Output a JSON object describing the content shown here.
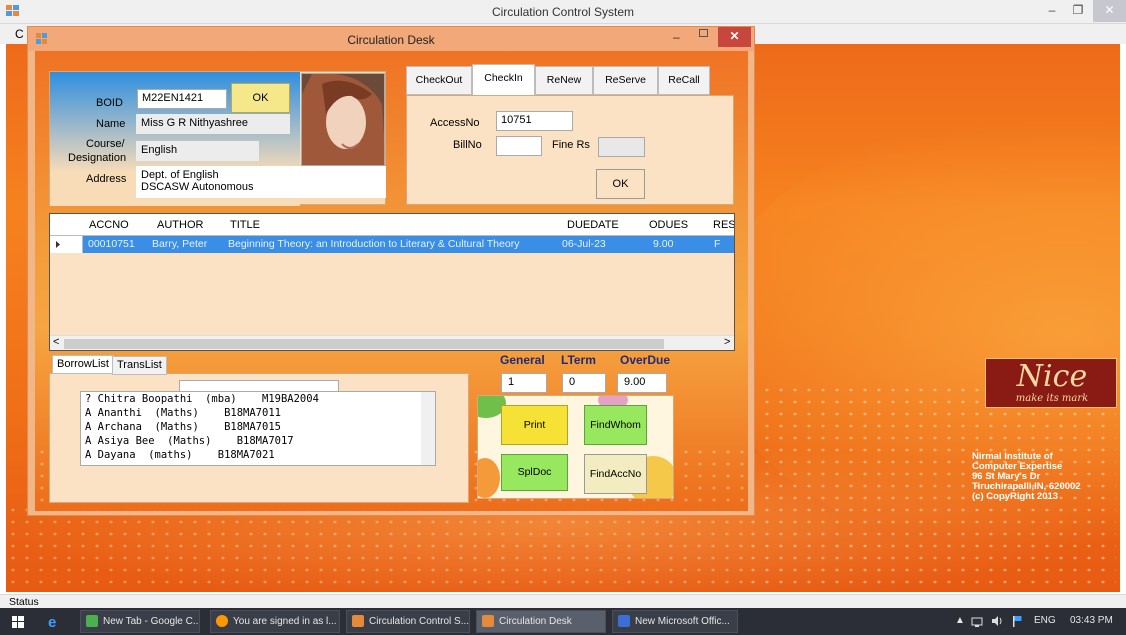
{
  "main_window": {
    "title": "Circulation Control System",
    "menu_first": "C",
    "min": "–",
    "max": "❐",
    "close": "✕"
  },
  "child_window": {
    "title": "Circulation Desk",
    "min": "–",
    "close": "✕"
  },
  "member": {
    "boid_label": "BOID",
    "boid_value": "M22EN1421",
    "ok_label": "OK",
    "name_label": "Name",
    "name_value": "Miss G R Nithyashree",
    "course_label": "Course/",
    "designation_label": "Designation",
    "course_value": "English",
    "address_label": "Address",
    "address_line1": "Dept. of English",
    "address_line2": "DSCASW Autonomous"
  },
  "tabs": {
    "items": [
      "CheckOut",
      "CheckIn",
      "ReNew",
      "ReServe",
      "ReCall"
    ],
    "active": "CheckIn",
    "accessno_label": "AccessNo",
    "accessno_value": "10751",
    "billno_label": "BillNo",
    "billno_value": "",
    "finers_label": "Fine Rs",
    "finers_value": "",
    "ok_label": "OK"
  },
  "grid": {
    "columns": [
      "ACCNO",
      "AUTHOR",
      "TITLE",
      "DUEDATE",
      "ODUES",
      "RES"
    ],
    "rows": [
      {
        "accno": "00010751",
        "author": "Barry, Peter",
        "title": "Beginning Theory: an Introduction to Literary & Cultural Theory",
        "duedate": "06-Jul-23",
        "odues": "9.00",
        "res": "F"
      }
    ],
    "scroll_left": "<",
    "scroll_right": ">"
  },
  "borrow": {
    "tabs": [
      "BorrowList",
      "TransList"
    ],
    "active_tab": "BorrowList",
    "search_value": "",
    "list": [
      "? Chitra Boopathi  (mba)    M19BA2004",
      "A Ananthi  (Maths)    B18MA7011",
      "A Archana  (Maths)    B18MA7015",
      "A Asiya Bee  (Maths)    B18MA7017",
      "A Dayana  (maths)    B18MA7021"
    ]
  },
  "counters": {
    "general_label": "General",
    "general_value": "1",
    "lterm_label": "LTerm",
    "lterm_value": "0",
    "overdue_label": "OverDue",
    "overdue_value": "9.00"
  },
  "actions": {
    "print": "Print",
    "findwhom": "FindWhom",
    "spldoc": "SplDoc",
    "findaccno": "FindAccNo"
  },
  "branding": {
    "logo_big": "Nice",
    "logo_small": "make its mark",
    "lines": [
      "Nirmal Institute of",
      "Computer Expertise",
      "96 St Mary's Dr",
      "Tiruchirapalli,IN, 620002",
      "(c) CopyRight 2013"
    ]
  },
  "statusbar": {
    "text": "Status"
  },
  "taskbar": {
    "items": [
      {
        "label": "New Tab - Google C...",
        "color": "#4caf50"
      },
      {
        "label": "You are signed in as l...",
        "color": "#ff9800"
      },
      {
        "label": "Circulation Control S...",
        "color": "#e48a3a"
      },
      {
        "label": "Circulation Desk",
        "color": "#e48a3a"
      },
      {
        "label": "New Microsoft Offic...",
        "color": "#3b6fd6"
      }
    ],
    "lang": "ENG",
    "time": "03:43 PM",
    "tray_arrow": "▲"
  },
  "colors": {
    "accent_orange": "#f6821f",
    "row_selected": "#3a8ee6",
    "button_green": "#97e85e",
    "button_yellow": "#f5e88a"
  }
}
